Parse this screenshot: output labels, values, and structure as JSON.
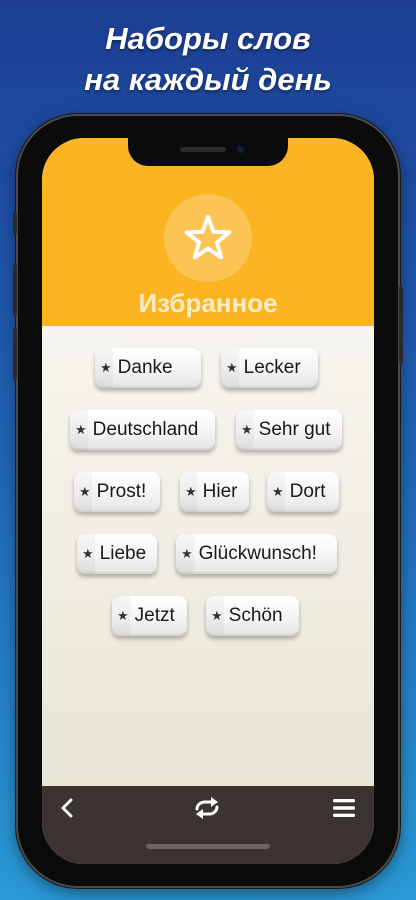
{
  "promo": {
    "line1": "Наборы слов",
    "line2": "на каждый день"
  },
  "header": {
    "title": "Избранное",
    "icon": "star-outline-icon",
    "accent": "#fbb523"
  },
  "words": [
    {
      "label": "Danke",
      "icon": "star-icon"
    },
    {
      "label": "Lecker",
      "icon": "star-icon"
    },
    {
      "label": "Deutschland",
      "icon": "star-icon"
    },
    {
      "label": "Sehr gut",
      "icon": "star-icon"
    },
    {
      "label": "Prost!",
      "icon": "star-icon"
    },
    {
      "label": "Hier",
      "icon": "star-icon"
    },
    {
      "label": "Dort",
      "icon": "star-icon"
    },
    {
      "label": "Liebe",
      "icon": "star-icon"
    },
    {
      "label": "Glückwunsch!",
      "icon": "star-icon"
    },
    {
      "label": "Jetzt",
      "icon": "star-icon"
    },
    {
      "label": "Schön",
      "icon": "star-icon"
    }
  ],
  "toolbar": {
    "back_icon": "chevron-left-icon",
    "shuffle_icon": "shuffle-icon",
    "menu_icon": "hamburger-menu-icon",
    "background": "#3b3431"
  }
}
